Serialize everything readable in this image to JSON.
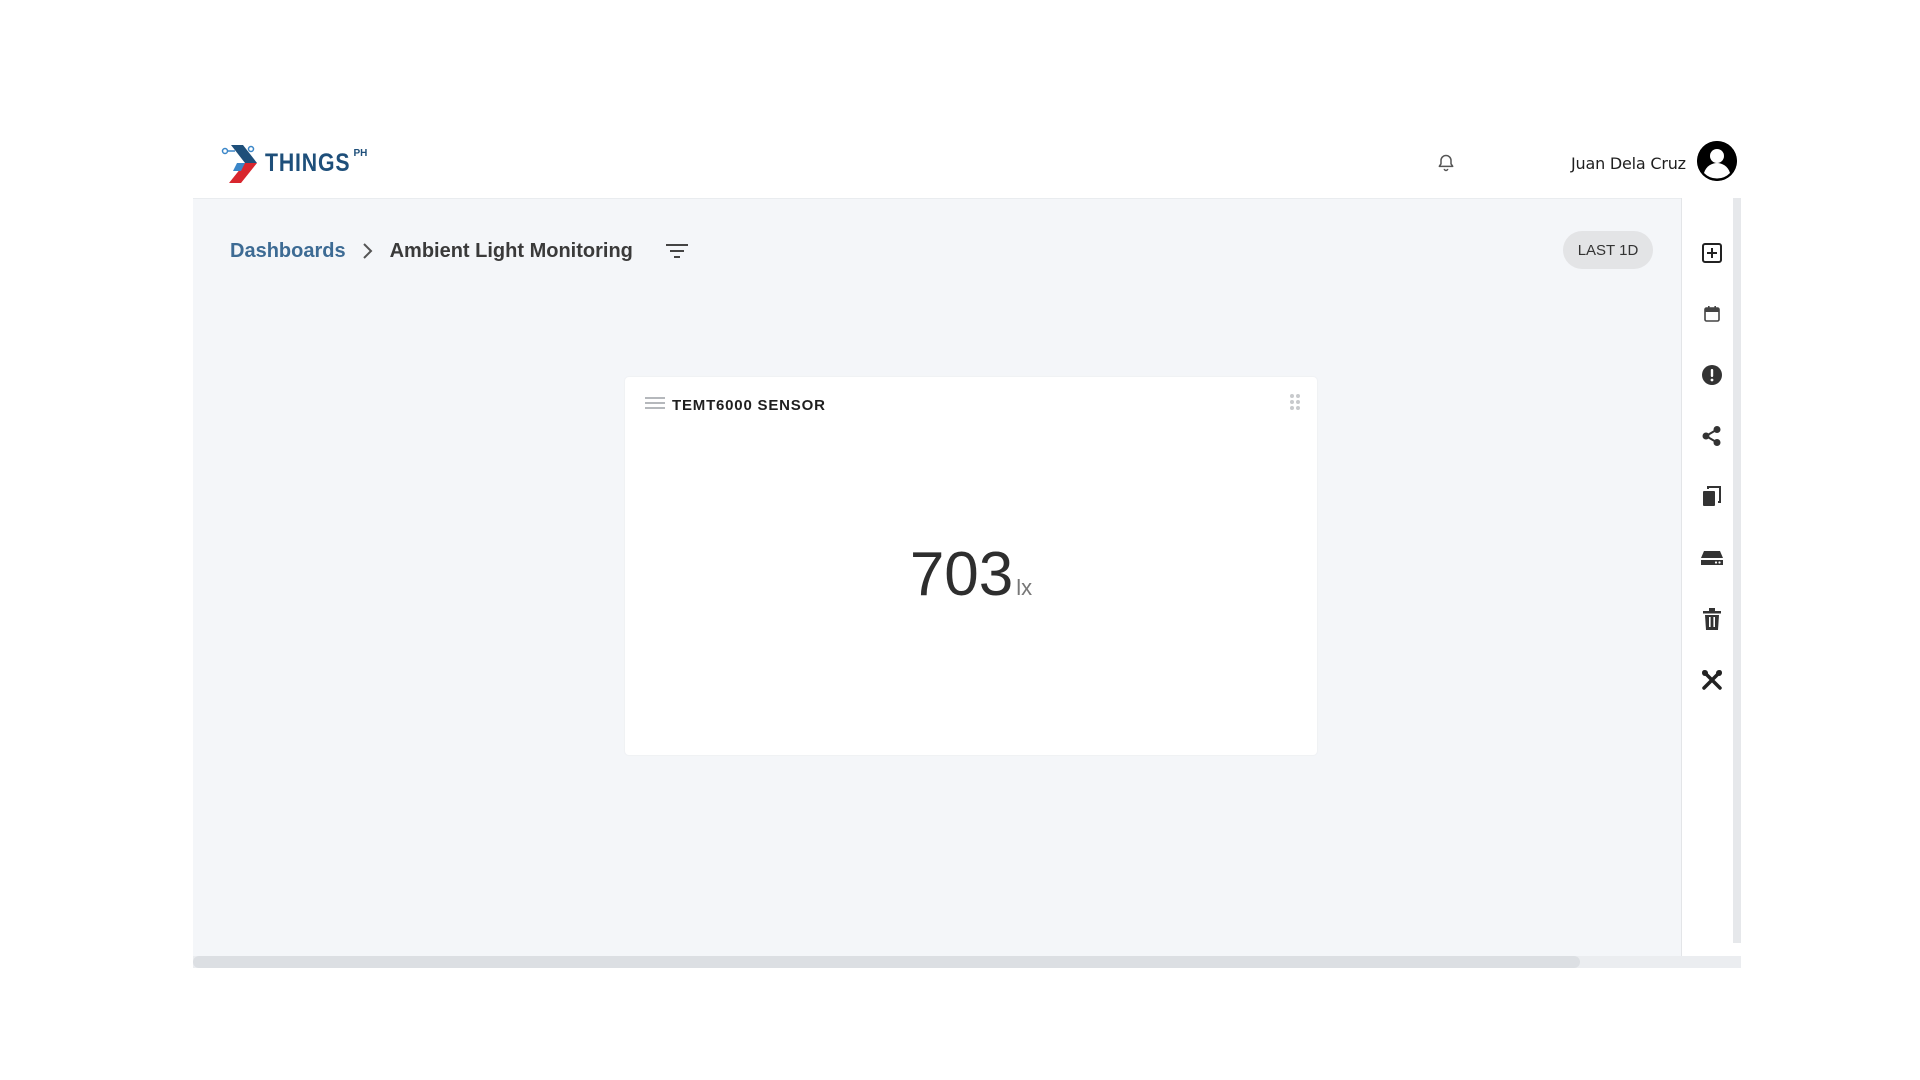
{
  "app": {
    "brand": "THINGS",
    "brand_sup": "PH",
    "user_name": "Juan Dela Cruz"
  },
  "breadcrumb": {
    "parent": "Dashboards",
    "current": "Ambient Light Monitoring"
  },
  "time_range": "LAST 1D",
  "widget": {
    "title": "TEMT6000 SENSOR",
    "value": "703",
    "unit": "lx"
  },
  "toolbar": {
    "items": [
      "add-widget-icon",
      "calendar-icon",
      "alert-icon",
      "share-icon",
      "copy-icon",
      "device-icon",
      "delete-icon",
      "settings-tools-icon"
    ]
  },
  "colors": {
    "brand_blue": "#1e4f7a",
    "brand_red": "#d8262e",
    "breadcrumb_link": "#3d6b94",
    "canvas_bg": "#f4f6f9"
  }
}
